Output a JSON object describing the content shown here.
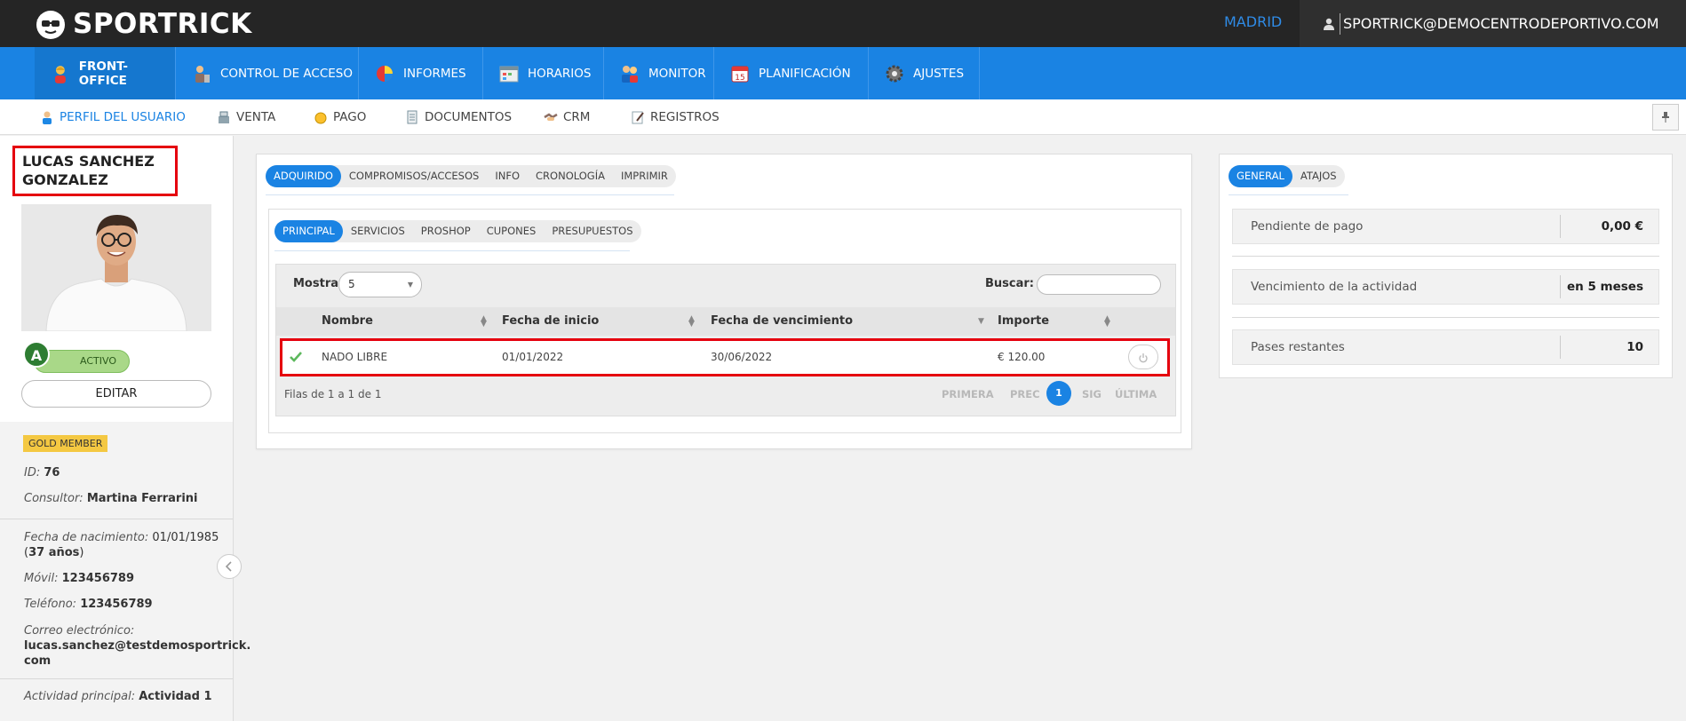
{
  "header": {
    "brand": "SPORTRICK",
    "city": "MADRID",
    "account": "SPORTRICK@DEMOCENTRODEPORTIVO.COM"
  },
  "main_nav": [
    {
      "label": "FRONT-OFFICE",
      "icon": "user-female-icon",
      "active": true
    },
    {
      "label": "CONTROL DE ACCESO",
      "icon": "access-control-icon",
      "active": false
    },
    {
      "label": "INFORMES",
      "icon": "pie-chart-icon",
      "active": false
    },
    {
      "label": "HORARIOS",
      "icon": "schedule-icon",
      "active": false
    },
    {
      "label": "MONITOR",
      "icon": "monitor-people-icon",
      "active": false
    },
    {
      "label": "PLANIFICACIÓN",
      "icon": "calendar-icon",
      "active": false
    },
    {
      "label": "AJUSTES",
      "icon": "gear-icon",
      "active": false
    }
  ],
  "sub_nav": [
    {
      "label": "PERFIL DEL USUARIO",
      "icon": "user-profile-icon",
      "active": true
    },
    {
      "label": "VENTA",
      "icon": "cash-register-icon",
      "active": false
    },
    {
      "label": "PAGO",
      "icon": "coin-icon",
      "active": false
    },
    {
      "label": "DOCUMENTOS",
      "icon": "document-icon",
      "active": false
    },
    {
      "label": "CRM",
      "icon": "handshake-icon",
      "active": false
    },
    {
      "label": "REGISTROS",
      "icon": "log-icon",
      "active": false
    }
  ],
  "profile": {
    "name_line1": "LUCAS SANCHEZ",
    "name_line2": "GONZALEZ",
    "status_letter": "A",
    "status": "ACTIVO",
    "edit_label": "EDITAR",
    "membership": "GOLD MEMBER",
    "id_label": "ID:",
    "id_value": "76",
    "consultant_label": "Consultor:",
    "consultant_value": "Martina Ferrarini",
    "birth_label": "Fecha de nacimiento:",
    "birth_value": "01/01/1985",
    "age_value": "37 años",
    "mobile_label": "Móvil:",
    "mobile_value": "123456789",
    "phone_label": "Teléfono:",
    "phone_value": "123456789",
    "email_label": "Correo electrónico:",
    "email_line1": "lucas.sanchez@testdemosportrick.",
    "email_line2": "com",
    "activity_label": "Actividad principal:",
    "activity_value": "Actividad 1"
  },
  "middle": {
    "tabs": [
      "ADQUIRIDO",
      "COMPROMISOS/ACCESOS",
      "INFO",
      "CRONOLOGÍA",
      "IMPRIMIR"
    ],
    "subtabs": [
      "PRINCIPAL",
      "SERVICIOS",
      "PROSHOP",
      "CUPONES",
      "PRESUPUESTOS"
    ],
    "show_label": "Mostrar",
    "show_value": "5",
    "search_label": "Buscar:",
    "search_value": "",
    "columns": [
      "Nombre",
      "Fecha de inicio",
      "Fecha de vencimiento",
      "Importe"
    ],
    "rows": [
      {
        "nombre": "NADO LIBRE",
        "inicio": "01/01/2022",
        "vencimiento": "30/06/2022",
        "importe": "€ 120.00"
      }
    ],
    "rows_info": "Filas de 1 a 1 de 1",
    "pager": {
      "first": "PRIMERA",
      "prev": "PREC",
      "current": "1",
      "next": "SIG",
      "last": "ÚLTIMA"
    }
  },
  "right": {
    "tabs": [
      "GENERAL",
      "ATAJOS"
    ],
    "items": [
      {
        "label": "Pendiente de pago",
        "value": "0,00 €"
      },
      {
        "label": "Vencimiento de la actividad",
        "value": "en 5 meses"
      },
      {
        "label": "Pases restantes",
        "value": "10"
      }
    ]
  },
  "colors": {
    "primary": "#1a83e3",
    "topbar": "#252525",
    "highlight": "#e5000e",
    "status_green": "#a9d888",
    "gold": "#f4c842"
  }
}
